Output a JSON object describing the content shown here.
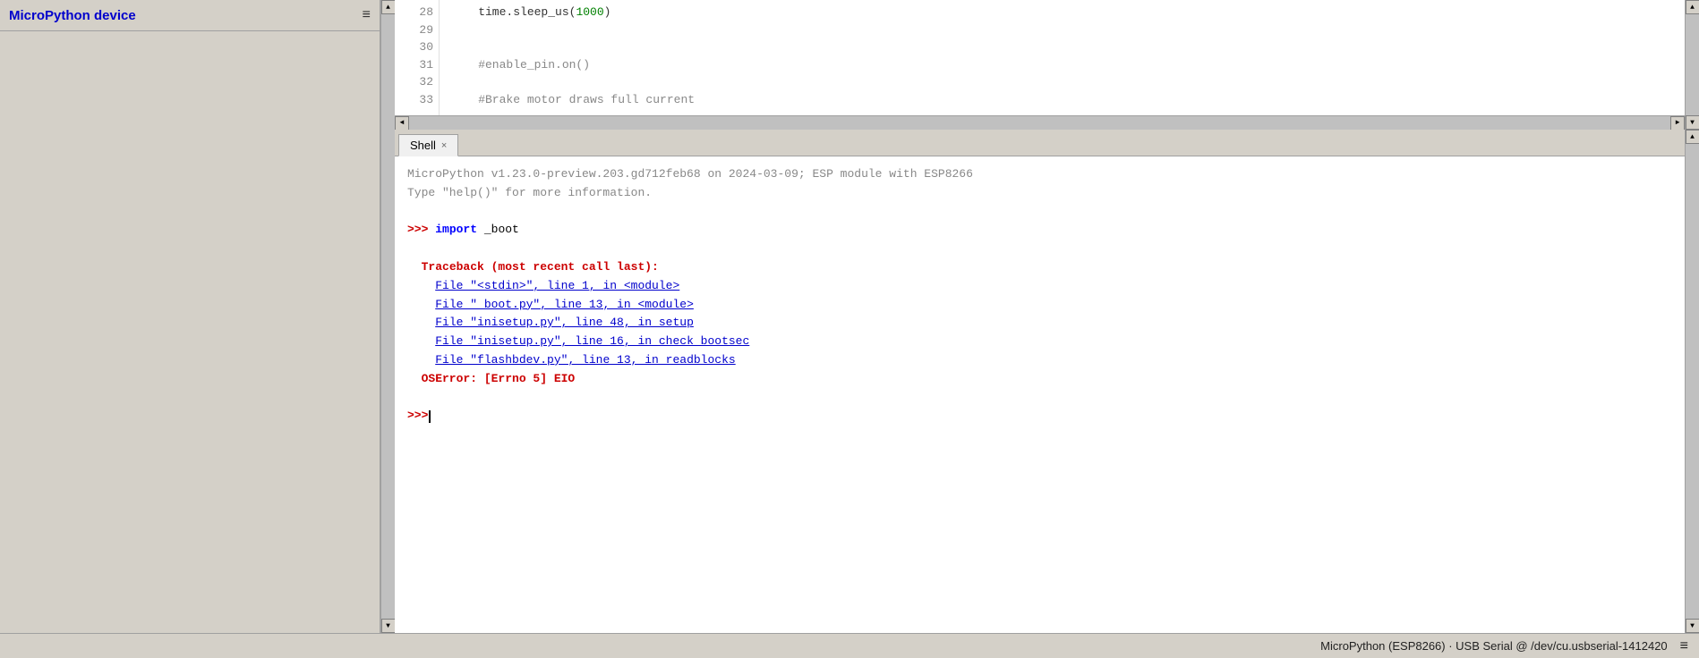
{
  "sidebar": {
    "title": "MicroPython device",
    "menu_icon": "≡"
  },
  "editor": {
    "lines": [
      {
        "num": "28",
        "content": "    time.sleep_us(1000)",
        "parts": [
          {
            "text": "    time.sleep_us(",
            "class": ""
          },
          {
            "text": "1000",
            "class": "kw-number"
          },
          {
            "text": ")",
            "class": ""
          }
        ]
      },
      {
        "num": "29",
        "content": ""
      },
      {
        "num": "30",
        "content": ""
      },
      {
        "num": "31",
        "content": "    #enable_pin.on()",
        "class": "kw-comment"
      },
      {
        "num": "32",
        "content": ""
      },
      {
        "num": "33",
        "content": "    #Brake motor draws full current",
        "class": "kw-comment"
      }
    ]
  },
  "shell": {
    "tab_label": "Shell",
    "tab_close": "×",
    "info_line1": "MicroPython v1.23.0-preview.203.gd712feb68 on 2024-03-09; ESP module with ESP8266",
    "info_line2": "Type \"help()\" for more information.",
    "prompt1": ">>> ",
    "import_kw": "import",
    "import_module": "_boot",
    "traceback_header": "Traceback (most recent call last):",
    "file1": "  File \"<stdin>\", line 1, in <module>",
    "file2": "  File \"_boot.py\", line 13, in <module>",
    "file3": "  File \"inisetup.py\", line 48, in setup",
    "file4": "  File \"inisetup.py\", line 16, in check_bootsec",
    "file5": "  File \"flashbdev.py\", line 13, in readblocks",
    "oserror": "OSError: [Errno 5] EIO",
    "prompt2": ">>> "
  },
  "status_bar": {
    "text": "MicroPython (ESP8266) · USB Serial @ /dev/cu.usbserial-1412420",
    "menu_icon": "≡"
  },
  "scrollbar": {
    "up_arrow": "▲",
    "down_arrow": "▼",
    "left_arrow": "◄",
    "right_arrow": "►"
  }
}
